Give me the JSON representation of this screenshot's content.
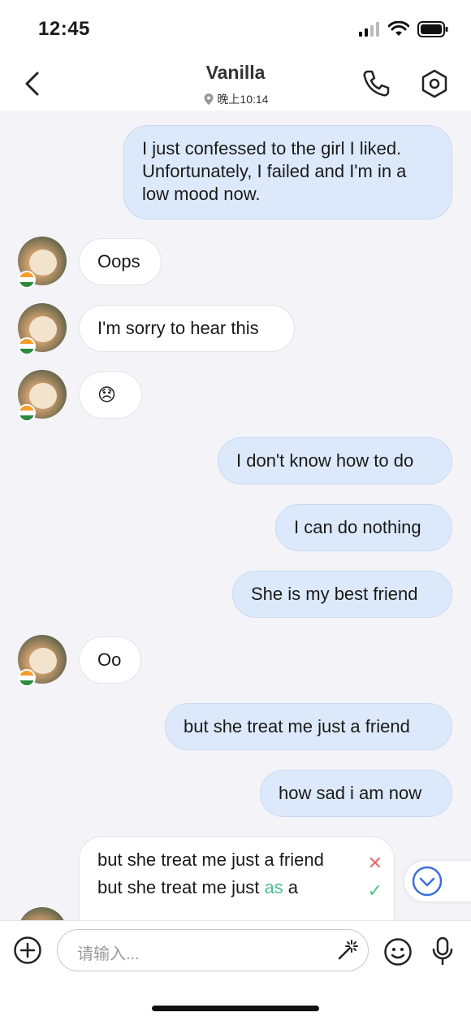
{
  "status_bar": {
    "time": "12:45"
  },
  "header": {
    "title": "Vanilla",
    "location_time": "晚上10:14"
  },
  "messages": [
    {
      "side": "out",
      "text": "I just confessed to the girl I liked. Unfortunately, I failed and I'm in a low mood now."
    },
    {
      "side": "in",
      "text": "Oops"
    },
    {
      "side": "in",
      "text": "I'm sorry to hear this"
    },
    {
      "side": "in",
      "text": "😞"
    },
    {
      "side": "out",
      "text": "I don't know how to do"
    },
    {
      "side": "out",
      "text": "I can do nothing"
    },
    {
      "side": "out",
      "text": "She is my best friend"
    },
    {
      "side": "in",
      "text": "Oo"
    },
    {
      "side": "out",
      "text": "but she treat me just a friend"
    },
    {
      "side": "out",
      "text": "how sad i am now"
    }
  ],
  "correction": {
    "wrong": "but she treat me just a friend",
    "right_before": "but she treat me just ",
    "right_highlight": "as",
    "right_after": " a",
    "wrong_mark": "✕",
    "right_mark": "✓",
    "highlight_color": "#4cc38a"
  },
  "input": {
    "placeholder": "请输入..."
  },
  "colors": {
    "out_bubble": "#dce9fb",
    "in_bubble": "#ffffff",
    "accent": "#3b6fd8"
  }
}
